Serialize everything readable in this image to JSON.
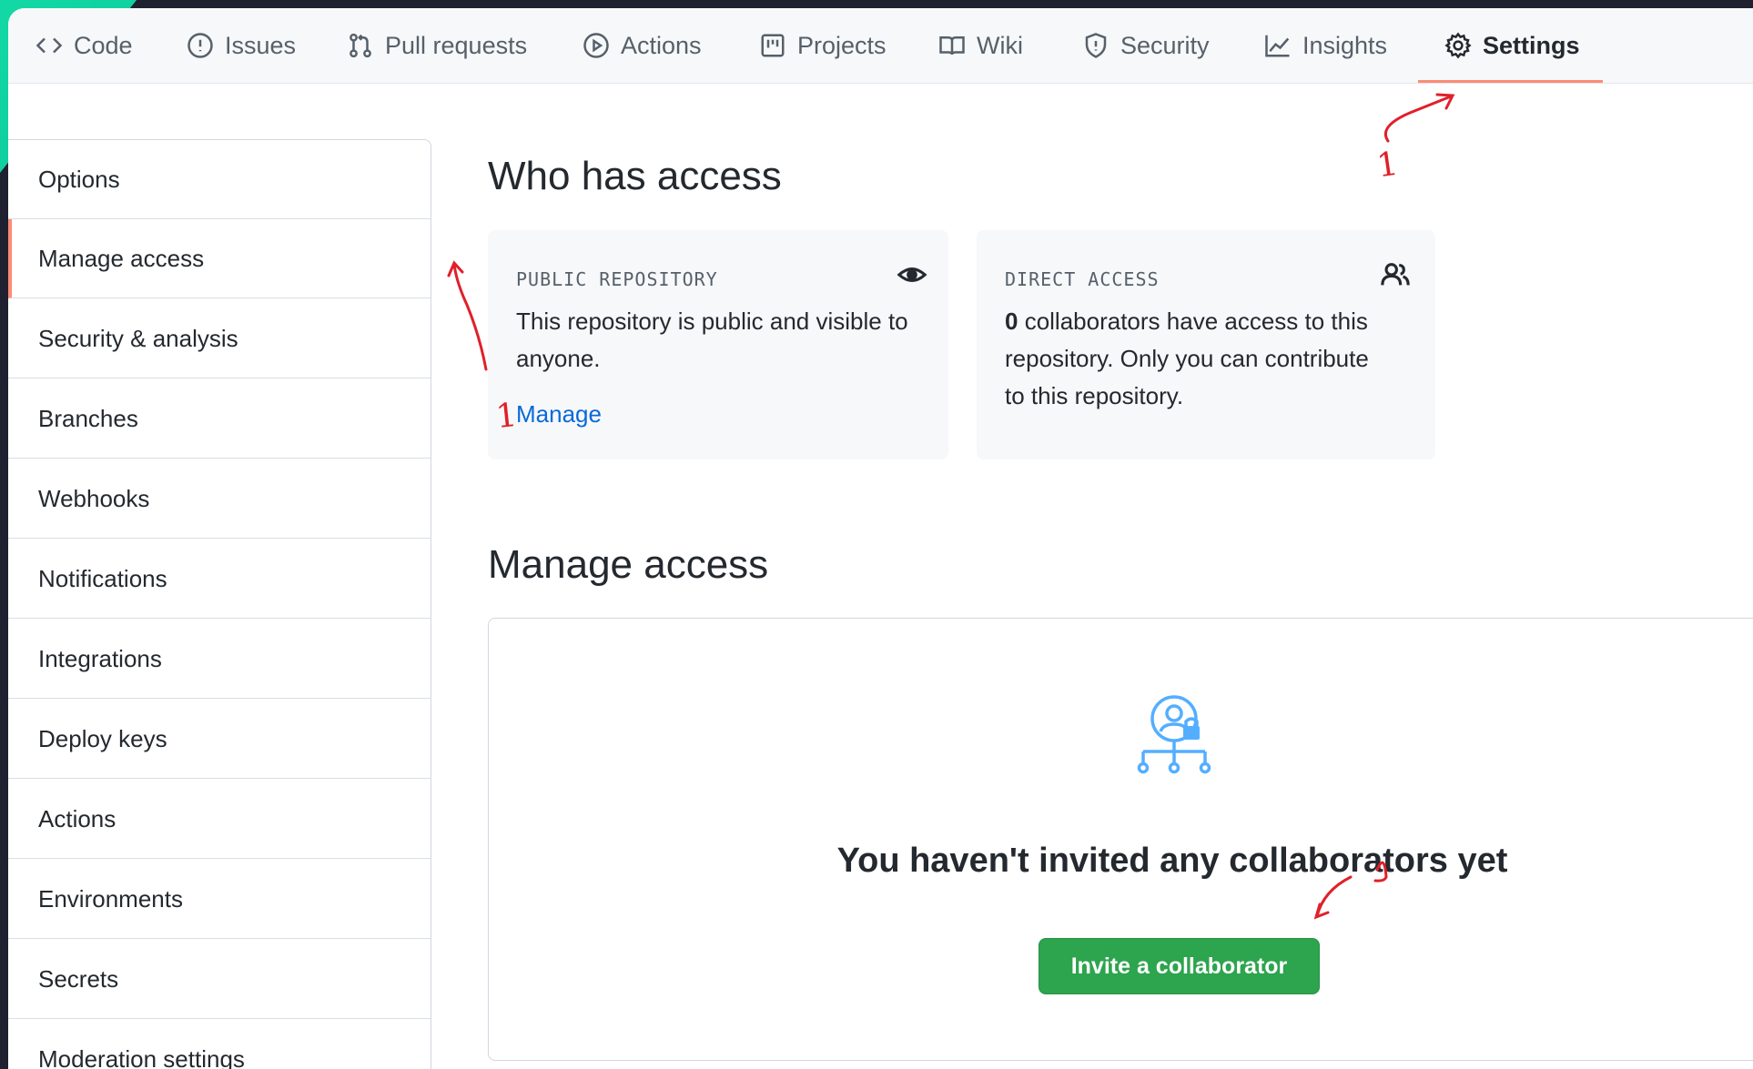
{
  "nav": {
    "tabs": [
      {
        "label": "Code",
        "icon": "code-icon"
      },
      {
        "label": "Issues",
        "icon": "issue-icon"
      },
      {
        "label": "Pull requests",
        "icon": "pull-request-icon"
      },
      {
        "label": "Actions",
        "icon": "play-icon"
      },
      {
        "label": "Projects",
        "icon": "project-icon"
      },
      {
        "label": "Wiki",
        "icon": "book-icon"
      },
      {
        "label": "Security",
        "icon": "shield-icon"
      },
      {
        "label": "Insights",
        "icon": "graph-icon"
      },
      {
        "label": "Settings",
        "icon": "gear-icon",
        "active": true
      }
    ]
  },
  "sidebar": {
    "items": [
      {
        "label": "Options"
      },
      {
        "label": "Manage access",
        "active": true
      },
      {
        "label": "Security & analysis"
      },
      {
        "label": "Branches"
      },
      {
        "label": "Webhooks"
      },
      {
        "label": "Notifications"
      },
      {
        "label": "Integrations"
      },
      {
        "label": "Deploy keys"
      },
      {
        "label": "Actions"
      },
      {
        "label": "Environments"
      },
      {
        "label": "Secrets"
      },
      {
        "label": "Moderation settings"
      }
    ]
  },
  "who_has_access": {
    "title": "Who has access",
    "public_card": {
      "label": "PUBLIC REPOSITORY",
      "text_line1": "This repository is public and visible to",
      "text_line2": "anyone.",
      "link": "Manage",
      "icon": "eye-icon"
    },
    "direct_card": {
      "label": "DIRECT ACCESS",
      "count": "0",
      "text_line1": " collaborators have access to this",
      "text_line2": "repository. Only you can contribute",
      "text_line3": "to this repository.",
      "icon": "people-icon"
    }
  },
  "manage_access": {
    "title": "Manage access",
    "empty_message": "You haven't invited any collaborators yet",
    "invite_button": "Invite a collaborator",
    "empty_icon": "person-lock-hierarchy-icon"
  },
  "colors": {
    "accent_underline": "#fd8c73",
    "link": "#0969da",
    "button_green": "#2da44e",
    "annotation_red": "#e0202a",
    "icon_blue": "#54aeff"
  }
}
